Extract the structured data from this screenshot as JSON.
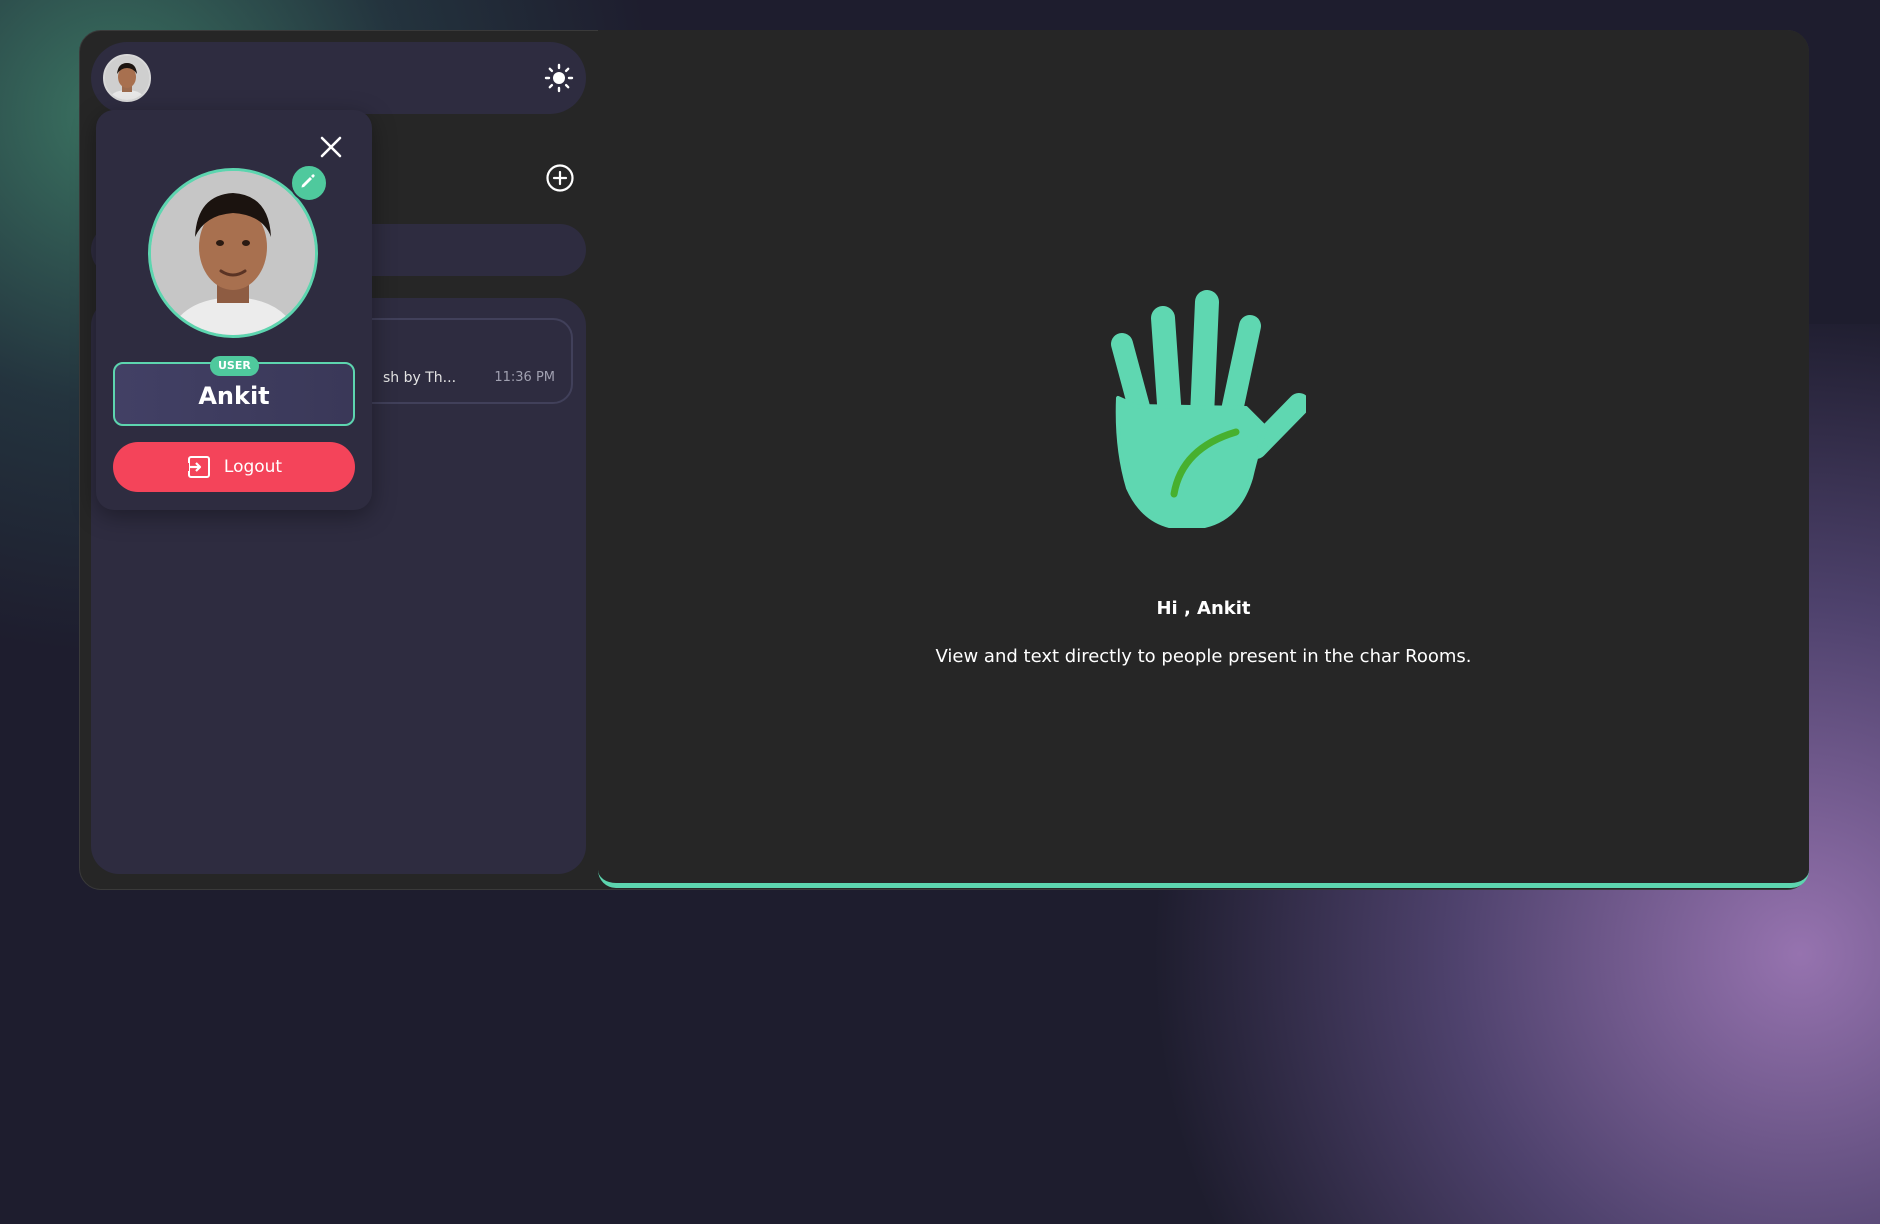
{
  "user": {
    "name": "Ankit",
    "role": "USER"
  },
  "profile_card": {
    "logout_label": "Logout"
  },
  "room_list": {
    "rooms": [
      {
        "preview": "sh by Th...",
        "time": "11:36 PM"
      }
    ]
  },
  "welcome": {
    "greeting": "Hi , Ankit",
    "message": "View and text directly to people present in the char Rooms."
  },
  "colors": {
    "accent": "#5dd5af",
    "danger": "#f4445a",
    "panel": "#2e2c40",
    "main_bg": "#262626"
  },
  "icons": [
    "sun-icon",
    "plus-circle-icon",
    "close-icon",
    "pencil-icon",
    "logout-icon",
    "waving-hand-icon"
  ]
}
